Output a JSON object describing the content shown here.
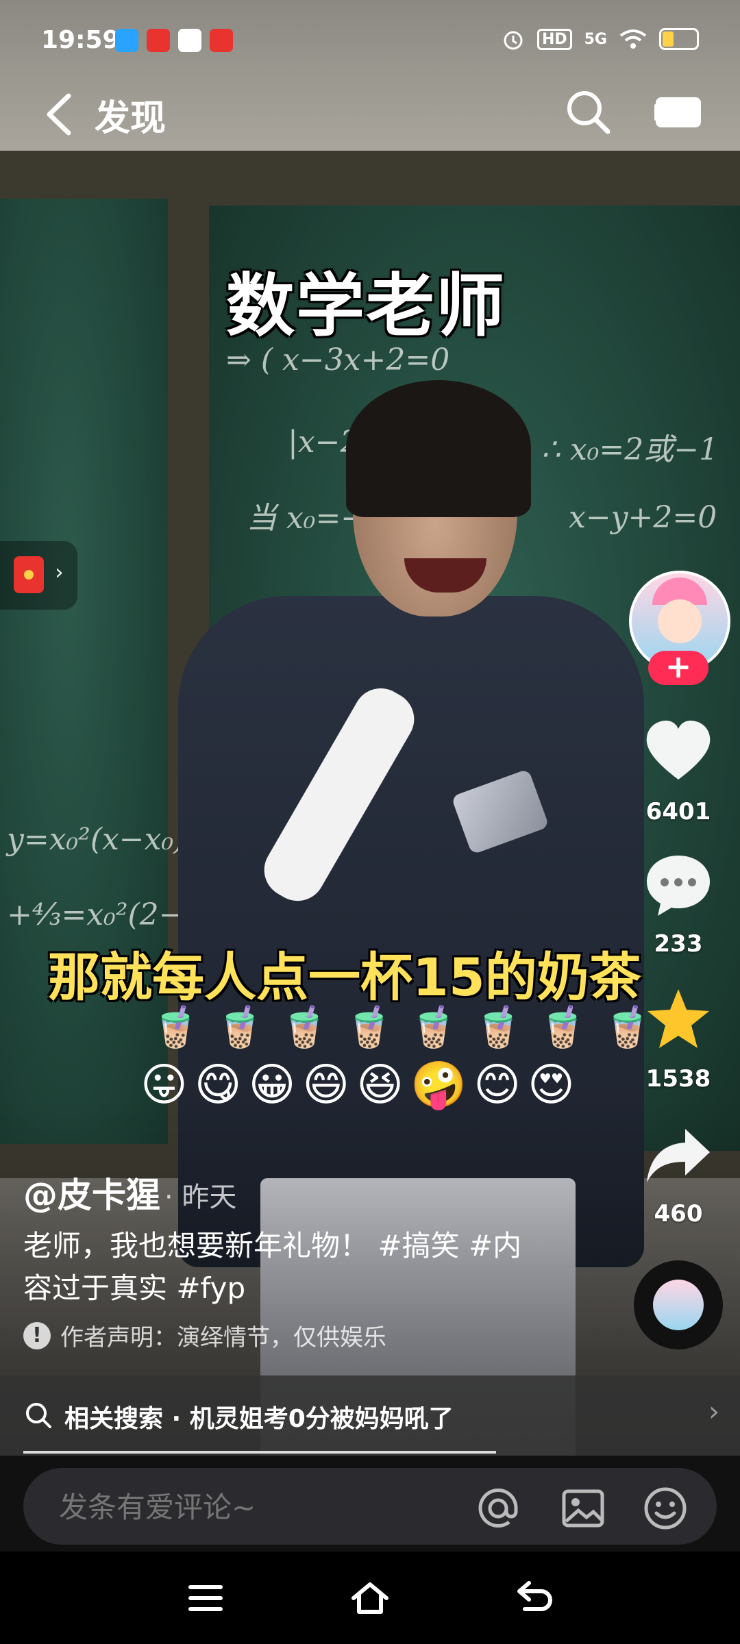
{
  "status_bar": {
    "time": "19:59",
    "hd": "HD",
    "network": "5G",
    "app_icons": [
      "paper-plane-app-icon",
      "listen-app-icon",
      "map-pin-app-icon",
      "heart-app-icon"
    ],
    "app_colors": [
      "#2aa3ff",
      "#e8332f",
      "#ffffff",
      "#e8332f"
    ]
  },
  "nav": {
    "title": "发现",
    "icons": [
      "back-chevron-icon",
      "search-icon",
      "camera-icon"
    ]
  },
  "video": {
    "caption_top": "数学老师",
    "caption_mid": "那就每人点一杯15的奶茶",
    "emoji_tea": "🧋🧋🧋🧋🧋🧋🧋🧋",
    "emoji_faces": "😛😋😀😄😆🤪😊😍"
  },
  "rail": {
    "follow": "+",
    "likes": "6401",
    "comments": "233",
    "favorites": "1538",
    "shares": "460",
    "icons": [
      "heart-icon",
      "comment-icon",
      "star-icon",
      "share-icon"
    ],
    "accent": "#ff2c55",
    "star_color": "#ffc62b"
  },
  "post": {
    "author": "@皮卡猩",
    "time_ago": "· 昨天",
    "description": "老师，我也想要新年礼物！ #搞笑 #内容过于真实 #fyp",
    "disclaimer": "作者声明：演绎情节，仅供娱乐"
  },
  "related": {
    "text": "相关搜索 · 机灵姐考0分被妈妈吼了"
  },
  "progress": {
    "value": 0.67
  },
  "comment_bar": {
    "placeholder": "发条有爱评论~",
    "icons": [
      "at-icon",
      "image-icon",
      "emoji-icon"
    ]
  },
  "system_nav": {
    "icons": [
      "menu-icon",
      "home-icon",
      "back-icon"
    ]
  }
}
